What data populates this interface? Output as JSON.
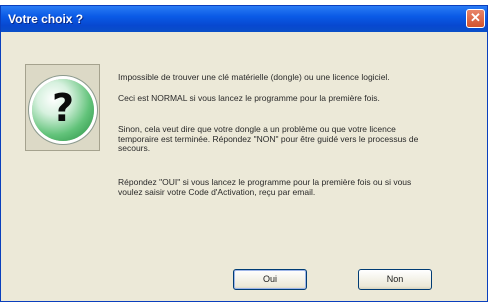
{
  "window": {
    "title": "Votre choix ?",
    "close_glyph": "✕"
  },
  "icon": {
    "name": "question-icon",
    "glyph": "?"
  },
  "message": {
    "p1": "Impossible de trouver une clé matérielle (dongle) ou une licence logiciel.",
    "p2": "Ceci est NORMAL si vous lancez le programme pour la première fois.",
    "p3": "Sinon, cela veut dire que votre dongle a un problème ou que votre licence temporaire est terminée. Répondez \"NON\" pour être guidé vers le processus de secours.",
    "p4": "Répondez \"OUI\" si vous lancez le programme pour la première fois ou si vous voulez saisir votre Code d'Activation, reçu par email."
  },
  "buttons": {
    "yes": "Oui",
    "no": "Non"
  },
  "colors": {
    "titlebar": "#0a5ae6",
    "dialog_bg": "#ece9d8",
    "close": "#d4532d",
    "icon_green": "#218a3c"
  }
}
